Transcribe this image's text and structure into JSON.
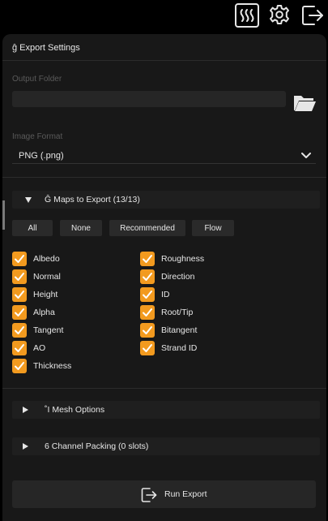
{
  "toolbar": {
    "icons": [
      "heat-waves-icon",
      "gear-icon",
      "export-exit-icon"
    ]
  },
  "panel": {
    "title": "ĝ Export Settings",
    "output_folder": {
      "label": "Output Folder",
      "value": ""
    },
    "image_format": {
      "label": "Image Format",
      "value": "PNG (.png)"
    },
    "maps_section": {
      "title": "Ĝ Maps to Export (13/13)",
      "expanded": true,
      "filter_buttons": [
        "All",
        "None",
        "Recommended",
        "Flow"
      ],
      "maps_left": [
        {
          "label": "Albedo",
          "checked": true
        },
        {
          "label": "Normal",
          "checked": true
        },
        {
          "label": "Height",
          "checked": true
        },
        {
          "label": "Alpha",
          "checked": true
        },
        {
          "label": "Tangent",
          "checked": true
        },
        {
          "label": "AO",
          "checked": true
        },
        {
          "label": "Thickness",
          "checked": true
        }
      ],
      "maps_right": [
        {
          "label": "Roughness",
          "checked": true
        },
        {
          "label": "Direction",
          "checked": true
        },
        {
          "label": "ID",
          "checked": true
        },
        {
          "label": "Root/Tip",
          "checked": true
        },
        {
          "label": "Bitangent",
          "checked": true
        },
        {
          "label": "Strand ID",
          "checked": true
        }
      ]
    },
    "mesh_section": {
      "title": "˚I Mesh Options",
      "expanded": false
    },
    "channel_section": {
      "title": "6 Channel Packing (0 slots)",
      "expanded": false
    },
    "run_button": {
      "label": "Run Export"
    }
  },
  "colors": {
    "accent": "#f29a1f",
    "panel_bg": "#181818",
    "field_bg": "#262626",
    "text": "#e6e6e6",
    "muted_text": "#5a5a5a"
  }
}
